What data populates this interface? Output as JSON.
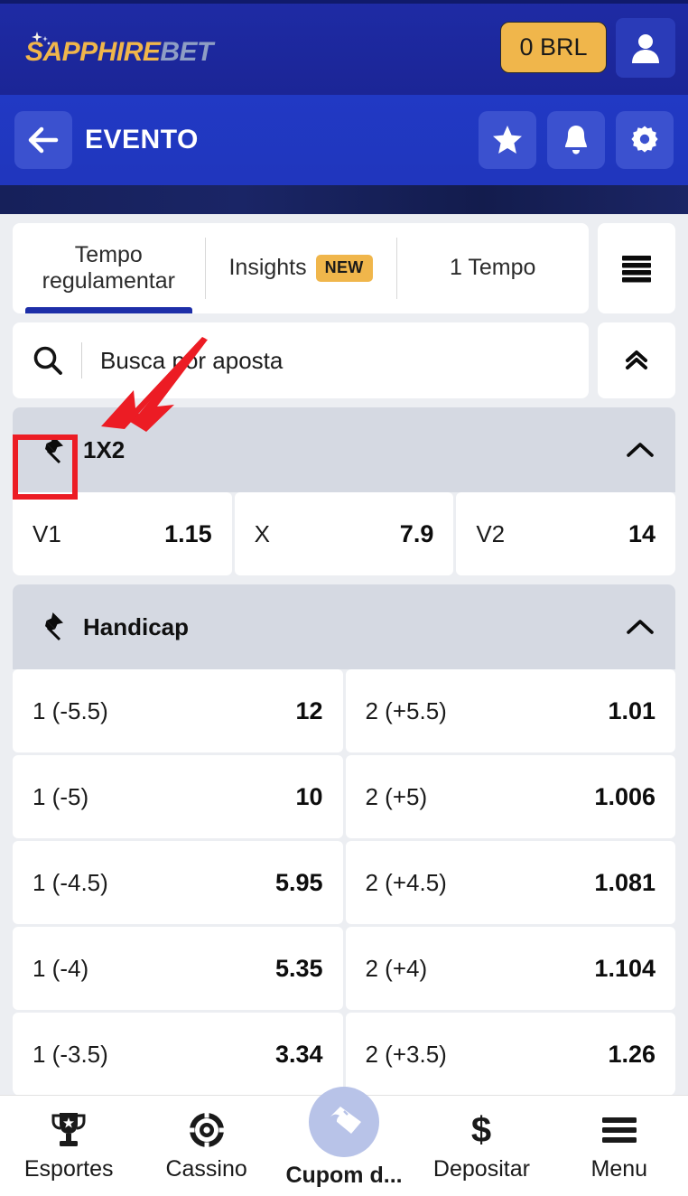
{
  "brand": {
    "name_primary": "SAPPHIRE",
    "name_secondary": "BET",
    "balance_label": "0 BRL",
    "avatar_icon": "user-icon",
    "sparkle_icon": "sparkle-icon",
    "accent_color": "#f0b64b",
    "header_color": "#1b2a9e"
  },
  "subnav": {
    "back_icon": "arrow-left-icon",
    "title": "EVENTO",
    "actions": [
      {
        "name": "favorite",
        "icon": "star-icon"
      },
      {
        "name": "notifications",
        "icon": "bell-icon"
      },
      {
        "name": "settings",
        "icon": "gear-icon"
      }
    ]
  },
  "tabs": [
    {
      "label": "Tempo\nregulamentar",
      "active": true,
      "badge": null
    },
    {
      "label": "Insights",
      "active": false,
      "badge": "NEW"
    },
    {
      "label": "1 Tempo",
      "active": false,
      "badge": null
    }
  ],
  "tabs_menu_icon": "hamburger-icon",
  "search": {
    "icon": "search-icon",
    "placeholder": "Busca por aposta",
    "value": "",
    "collapse_icon": "double-chevron-up-icon"
  },
  "markets": [
    {
      "pin_icon": "pin-icon",
      "title": "1X2",
      "collapse_icon": "chevron-up-icon",
      "layout": "three",
      "odds": [
        {
          "label": "V1",
          "value": "1.15"
        },
        {
          "label": "X",
          "value": "7.9"
        },
        {
          "label": "V2",
          "value": "14"
        }
      ]
    },
    {
      "pin_icon": "pin-icon",
      "title": "Handicap",
      "collapse_icon": "chevron-up-icon",
      "layout": "pairs",
      "rows": [
        [
          {
            "label": "1 (-5.5)",
            "value": "12"
          },
          {
            "label": "2 (+5.5)",
            "value": "1.01"
          }
        ],
        [
          {
            "label": "1 (-5)",
            "value": "10"
          },
          {
            "label": "2 (+5)",
            "value": "1.006"
          }
        ],
        [
          {
            "label": "1 (-4.5)",
            "value": "5.95"
          },
          {
            "label": "2 (+4.5)",
            "value": "1.081"
          }
        ],
        [
          {
            "label": "1 (-4)",
            "value": "5.35"
          },
          {
            "label": "2 (+4)",
            "value": "1.104"
          }
        ],
        [
          {
            "label": "1 (-3.5)",
            "value": "3.34"
          },
          {
            "label": "2 (+3.5)",
            "value": "1.26"
          }
        ]
      ]
    }
  ],
  "bottom_nav": [
    {
      "label": "Esportes",
      "icon": "trophy-icon",
      "featured": false
    },
    {
      "label": "Cassino",
      "icon": "casino-chip-icon",
      "featured": false
    },
    {
      "label": "Cupom d...",
      "icon": "ticket-icon",
      "featured": true
    },
    {
      "label": "Depositar",
      "icon": "dollar-icon",
      "featured": false
    },
    {
      "label": "Menu",
      "icon": "hamburger-icon",
      "featured": false
    }
  ],
  "annotations": {
    "highlight_box_target": "pin-icon-1x2",
    "arrow_color": "#ec1c24",
    "box_color": "#ec1c24"
  }
}
